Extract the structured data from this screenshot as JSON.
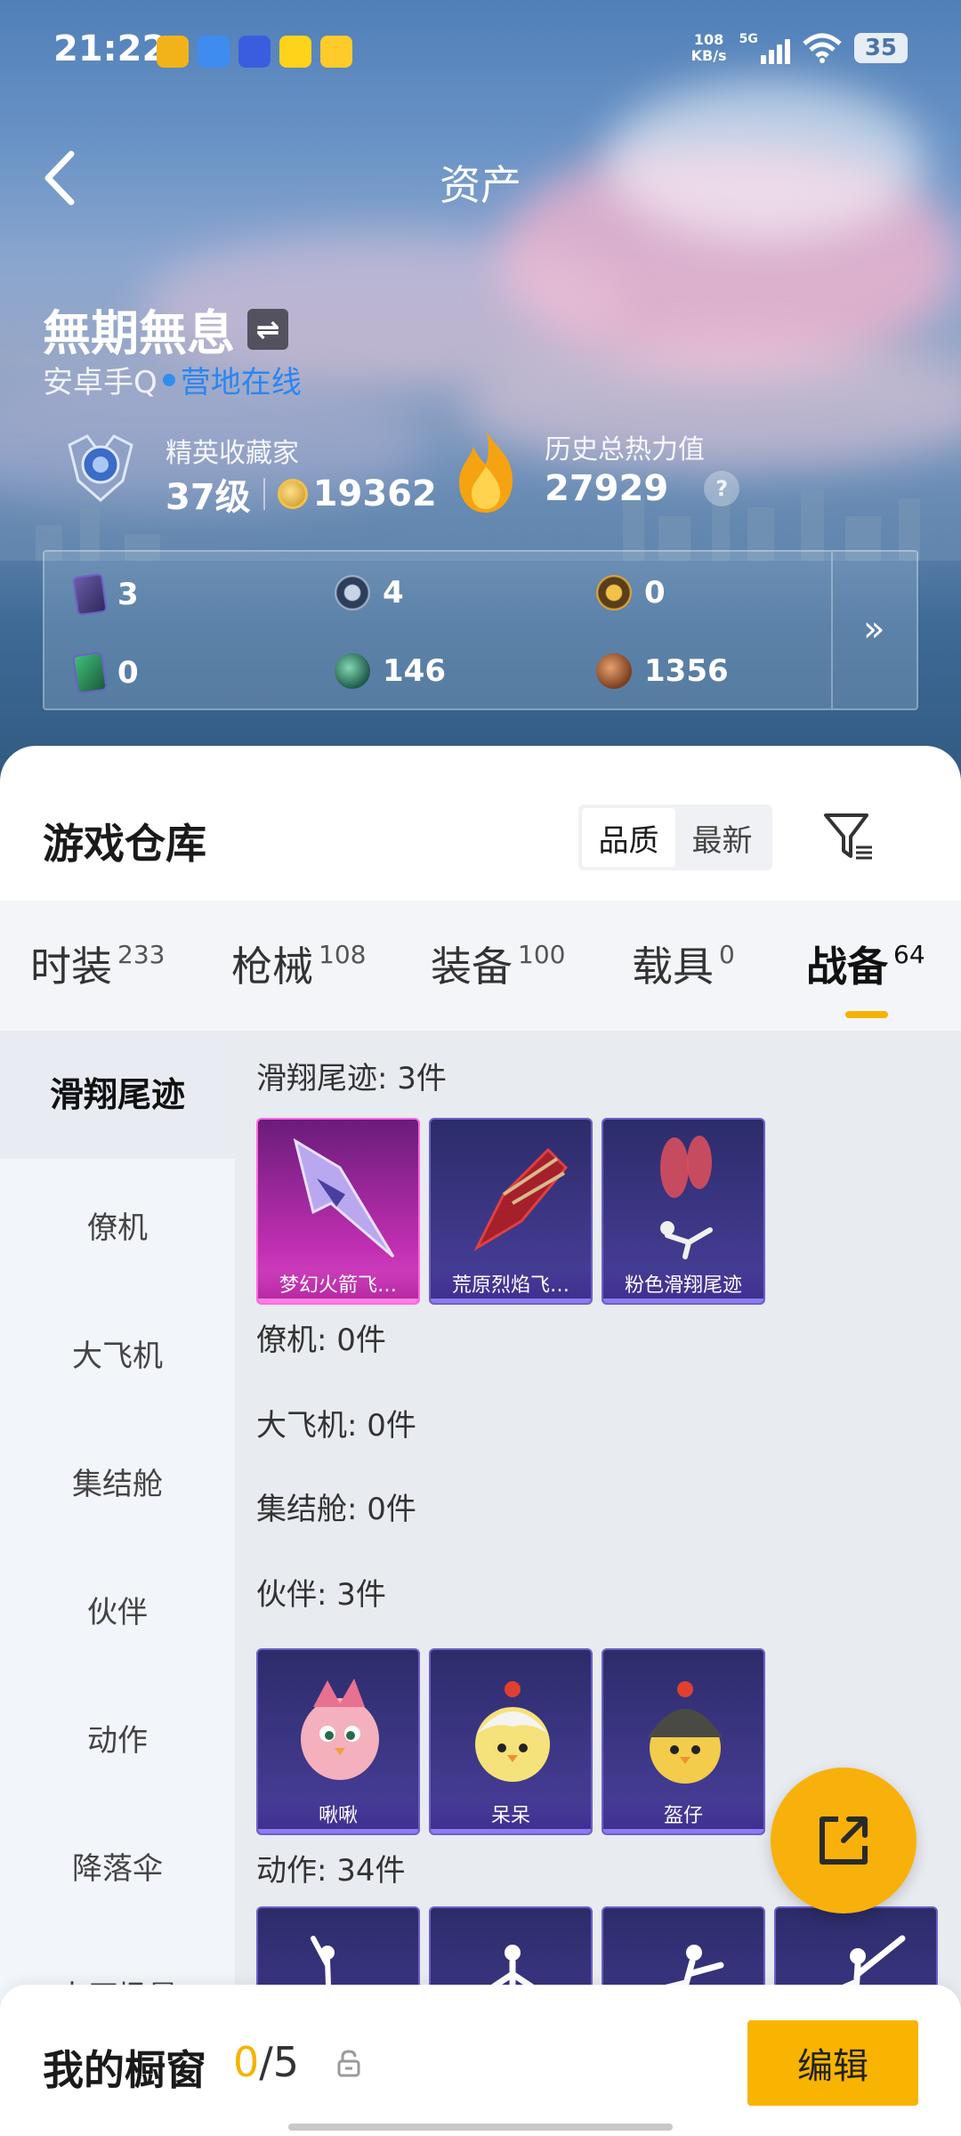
{
  "status_bar": {
    "time": "21:22",
    "net_speed_value": "108",
    "net_speed_unit": "KB/s",
    "network_type": "5G",
    "battery": "35"
  },
  "header": {
    "title": "资产"
  },
  "profile": {
    "name": "無期無息",
    "platform": "安卓手Q",
    "online_status": "营地在线",
    "rank_title": "精英收藏家",
    "level": "37级",
    "coins": "19362",
    "heat_title": "历史总热力值",
    "heat_value": "27929",
    "help": "?"
  },
  "assets": [
    {
      "icon": "purple-card-icon",
      "value": "3"
    },
    {
      "icon": "silver-medal-icon",
      "value": "4"
    },
    {
      "icon": "gold-medal-icon",
      "value": "0"
    },
    {
      "icon": "green-card-icon",
      "value": "0"
    },
    {
      "icon": "green-orb-icon",
      "value": "146"
    },
    {
      "icon": "bronze-coin-icon",
      "value": "1356"
    }
  ],
  "warehouse": {
    "title": "游戏仓库",
    "sort_options": [
      "品质",
      "最新"
    ],
    "sort_selected": "品质",
    "tabs": [
      {
        "label": "时装",
        "count": "233"
      },
      {
        "label": "枪械",
        "count": "108"
      },
      {
        "label": "装备",
        "count": "100"
      },
      {
        "label": "载具",
        "count": "0"
      },
      {
        "label": "战备",
        "count": "64"
      }
    ],
    "active_tab": "战备",
    "side_nav": [
      "滑翔尾迹",
      "僚机",
      "大飞机",
      "集结舱",
      "伙伴",
      "动作",
      "降落伞",
      "大厅场景"
    ],
    "active_side": "滑翔尾迹",
    "sections": [
      {
        "title": "滑翔尾迹: 3件",
        "items": [
          "梦幻火箭飞…",
          "荒原烈焰飞…",
          "粉色滑翔尾迹"
        ]
      },
      {
        "title": "僚机: 0件"
      },
      {
        "title": "大飞机: 0件"
      },
      {
        "title": "集结舱: 0件"
      },
      {
        "title": "伙伴: 3件",
        "items": [
          "啾啾",
          "呆呆",
          "盔仔"
        ]
      },
      {
        "title": "动作: 34件"
      }
    ]
  },
  "bottom_bar": {
    "window_label": "我的橱窗",
    "current": "0",
    "total": "/5",
    "edit_label": "编辑"
  },
  "colors": {
    "accent": "#f8b400",
    "online": "#2a86f0",
    "card_purple": "#4a3f9c",
    "card_pink": "#c02fb2"
  }
}
